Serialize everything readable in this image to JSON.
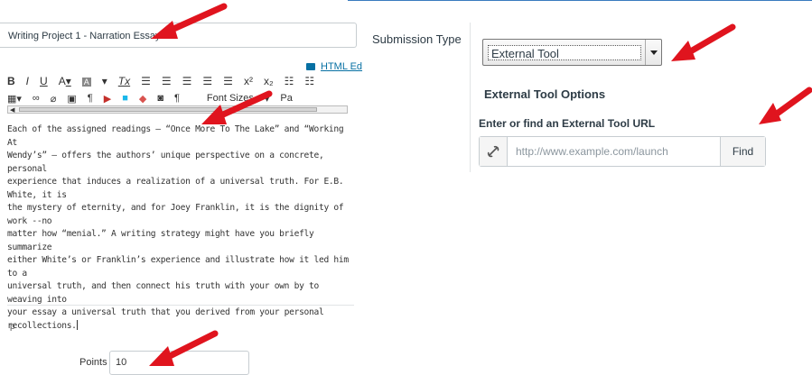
{
  "assignment": {
    "title_value": "Writing Project 1 - Narration Essay"
  },
  "editor": {
    "html_editor_link": "HTML Ed",
    "toolbar_row1": [
      "B",
      "I",
      "U",
      "A",
      "A",
      "Tx"
    ],
    "font_sizes_label": "Font Sizes",
    "paragraph_label": "Pa",
    "body_lines": [
      "Each of the assigned readings – “Once More To The Lake” and “Working At",
      "Wendy’s” – offers the authors’ unique perspective on a concrete, personal",
      "experience that induces a realization of a universal truth. For E.B. White, it is",
      "the mystery of eternity, and for Joey Franklin, it is the dignity of work --no",
      "matter how “menial.” A writing strategy might have you briefly summarize",
      "either White’s or Franklin’s experience and illustrate how it led him to a",
      "universal truth, and then connect his truth with your own by to weaving into",
      "your essay a universal truth that you derived from your personal",
      "recollections."
    ],
    "path_indicator": "p"
  },
  "points": {
    "label": "Points",
    "value": "10"
  },
  "submission": {
    "label": "Submission Type",
    "selected": "External Tool",
    "options_heading": "External Tool Options",
    "url_label": "Enter or find an External Tool URL",
    "url_placeholder": "http://www.example.com/launch",
    "find_button": "Find"
  },
  "colors": {
    "annotation_arrow": "#e0141e",
    "link": "#0770a3",
    "accent_line": "#3a7bbf"
  }
}
